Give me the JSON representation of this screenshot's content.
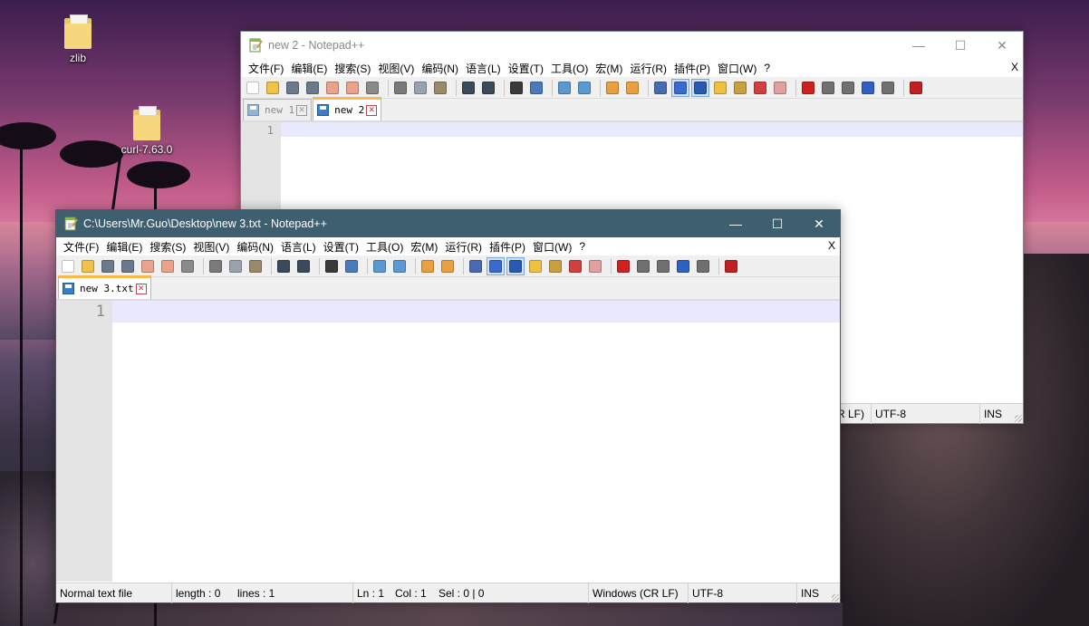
{
  "desktop": {
    "icons": [
      {
        "label": "zlib"
      },
      {
        "label": "curl-7.63.0"
      }
    ]
  },
  "back_window": {
    "title": "new 2 - Notepad++",
    "controls": {
      "minimize": "—",
      "maximize": "☐",
      "close": "✕"
    },
    "menu": [
      "文件(F)",
      "编辑(E)",
      "搜索(S)",
      "视图(V)",
      "编码(N)",
      "语言(L)",
      "设置(T)",
      "工具(O)",
      "宏(M)",
      "运行(R)",
      "插件(P)",
      "窗口(W)",
      "?"
    ],
    "menu_close": "X",
    "tabs": [
      {
        "label": "new 1",
        "close": "✕"
      },
      {
        "label": "new 2",
        "close": "✕"
      }
    ],
    "line_number": "1",
    "status": {
      "eol_partial": "R LF)",
      "encoding": "UTF-8",
      "mode": "INS"
    }
  },
  "front_window": {
    "title": "C:\\Users\\Mr.Guo\\Desktop\\new 3.txt - Notepad++",
    "controls": {
      "minimize": "—",
      "maximize": "☐",
      "close": "✕"
    },
    "menu": [
      "文件(F)",
      "编辑(E)",
      "搜索(S)",
      "视图(V)",
      "编码(N)",
      "语言(L)",
      "设置(T)",
      "工具(O)",
      "宏(M)",
      "运行(R)",
      "插件(P)",
      "窗口(W)",
      "?"
    ],
    "menu_close": "X",
    "tabs": [
      {
        "label": "new 3.txt",
        "close": "✕"
      }
    ],
    "line_number": "1",
    "status": {
      "file_type": "Normal text file",
      "length": "length : 0",
      "lines": "lines : 1",
      "ln": "Ln : 1",
      "col": "Col : 1",
      "sel": "Sel : 0 | 0",
      "eol": "Windows (CR LF)",
      "encoding": "UTF-8",
      "mode": "INS"
    }
  },
  "toolbar_icons": [
    "new-file-icon",
    "open-file-icon",
    "save-icon",
    "save-all-icon",
    "close-icon",
    "close-all-icon",
    "print-icon",
    "sep",
    "cut-icon",
    "copy-icon",
    "paste-icon",
    "sep",
    "undo-icon",
    "redo-icon",
    "sep",
    "find-icon",
    "replace-icon",
    "sep",
    "zoom-in-icon",
    "zoom-out-icon",
    "sep",
    "sync-vertical-icon",
    "sync-horizontal-icon",
    "sep",
    "word-wrap-icon",
    "show-all-chars-icon",
    "indent-guide-icon",
    "doc-map-icon",
    "function-list-icon",
    "folder-workspace-icon",
    "monitor-icon",
    "sep",
    "record-macro-icon",
    "stop-macro-icon",
    "play-macro-icon",
    "run-macro-multiple-icon",
    "save-macro-icon",
    "sep",
    "spell-check-icon"
  ],
  "colors": {
    "front_titlebar": "#3d5f6f",
    "back_titlebar": "#ffffff",
    "tab_accent": "#fab84a",
    "current_line": "#e8e8ff"
  }
}
